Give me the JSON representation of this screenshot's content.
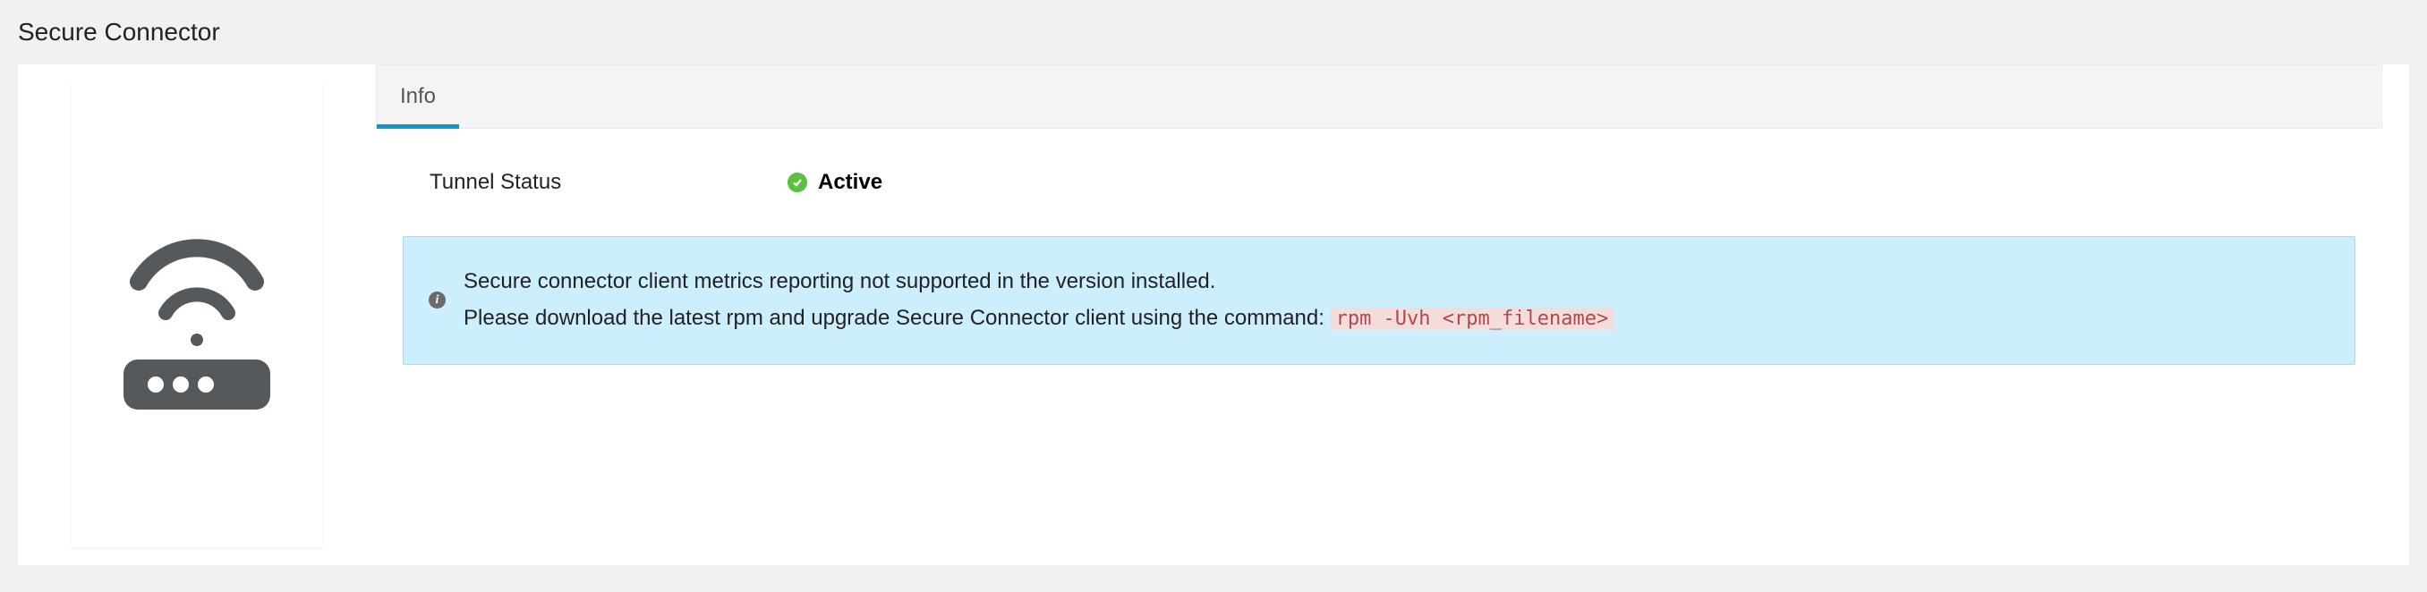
{
  "page": {
    "title": "Secure Connector"
  },
  "tabs": {
    "info": "Info"
  },
  "status": {
    "label": "Tunnel Status",
    "value": "Active"
  },
  "alert": {
    "line1": "Secure connector client metrics reporting not supported in the version installed.",
    "line2_prefix": "Please download the latest rpm and upgrade Secure Connector client using the command: ",
    "command": "rpm -Uvh <rpm_filename>"
  }
}
